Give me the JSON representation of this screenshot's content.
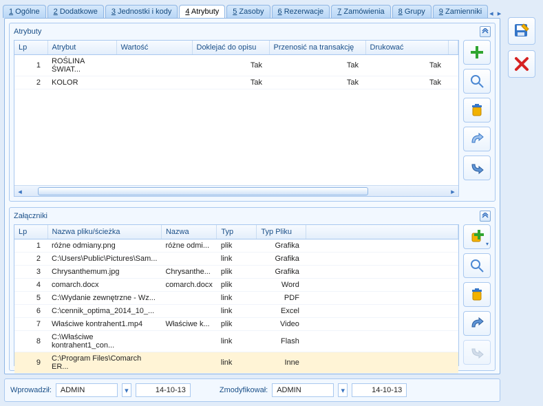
{
  "tabs": [
    {
      "prefix": "1",
      "label": "Ogólne"
    },
    {
      "prefix": "2",
      "label": "Dodatkowe"
    },
    {
      "prefix": "3",
      "label": "Jednostki i kody"
    },
    {
      "prefix": "4",
      "label": "Atrybuty"
    },
    {
      "prefix": "5",
      "label": "Zasoby"
    },
    {
      "prefix": "6",
      "label": "Rezerwacje"
    },
    {
      "prefix": "7",
      "label": "Zamówienia"
    },
    {
      "prefix": "8",
      "label": "Grupy"
    },
    {
      "prefix": "9",
      "label": "Zamienniki"
    }
  ],
  "active_tab_index": 3,
  "attributes": {
    "title": "Atrybuty",
    "columns": {
      "lp": "Lp",
      "attr": "Atrybut",
      "value": "Wartość",
      "append": "Doklejać do opisu",
      "transfer": "Przenosić na transakcję",
      "print": "Drukować"
    },
    "rows": [
      {
        "lp": "1",
        "attr": "ROŚLINA ŚWIAT...",
        "value": "",
        "append": "Tak",
        "transfer": "Tak",
        "print": "Tak"
      },
      {
        "lp": "2",
        "attr": "KOLOR",
        "value": "",
        "append": "Tak",
        "transfer": "Tak",
        "print": "Tak"
      }
    ]
  },
  "attachments": {
    "title": "Załączniki",
    "columns": {
      "lp": "Lp",
      "path": "Nazwa pliku/ścieżka",
      "name": "Nazwa",
      "type": "Typ",
      "ftype": "Typ Pliku"
    },
    "rows": [
      {
        "lp": "1",
        "path": "różne odmiany.png",
        "name": "różne odmi...",
        "type": "plik",
        "ftype": "Grafika"
      },
      {
        "lp": "2",
        "path": "C:\\Users\\Public\\Pictures\\Sam...",
        "name": "",
        "type": "link",
        "ftype": "Grafika"
      },
      {
        "lp": "3",
        "path": "Chrysanthemum.jpg",
        "name": "Chrysanthe...",
        "type": "plik",
        "ftype": "Grafika"
      },
      {
        "lp": "4",
        "path": "comarch.docx",
        "name": "comarch.docx",
        "type": "plik",
        "ftype": "Word"
      },
      {
        "lp": "5",
        "path": "C:\\Wydanie zewnętrzne - Wz...",
        "name": "",
        "type": "link",
        "ftype": "PDF"
      },
      {
        "lp": "6",
        "path": "C:\\cennik_optima_2014_10_...",
        "name": "",
        "type": "link",
        "ftype": "Excel"
      },
      {
        "lp": "7",
        "path": "Właściwe kontrahent1.mp4",
        "name": "Właściwe k...",
        "type": "plik",
        "ftype": "Video"
      },
      {
        "lp": "8",
        "path": "C:\\Właściwe kontrahent1_con...",
        "name": "",
        "type": "link",
        "ftype": "Flash"
      },
      {
        "lp": "9",
        "path": "C:\\Program Files\\Comarch ER...",
        "name": "",
        "type": "link",
        "ftype": "Inne"
      }
    ]
  },
  "footer": {
    "created_label": "Wprowadził:",
    "created_user": "ADMIN",
    "created_date": "14-10-13",
    "modified_label": "Zmodyfikował:",
    "modified_user": "ADMIN",
    "modified_date": "14-10-13"
  }
}
